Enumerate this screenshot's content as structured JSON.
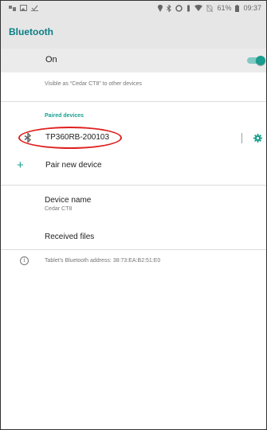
{
  "status_bar": {
    "left_icons": [
      "notification-icon",
      "image-icon",
      "checkmark-icon"
    ],
    "right_icons": [
      "location-icon",
      "bluetooth-icon",
      "data-saver-icon",
      "vibrate-icon",
      "wifi-icon",
      "no-sim-icon",
      "battery-icon"
    ],
    "battery_percent": "61%",
    "time": "09:37"
  },
  "app_bar": {
    "title": "Bluetooth"
  },
  "toggle": {
    "label": "On",
    "state": true,
    "accent": "#1a9c8e"
  },
  "visible_text": "Visible as “Cedar CT8” to other devices",
  "paired": {
    "header": "Paired devices",
    "devices": [
      {
        "name": "TP360RB-200103",
        "icon": "bluetooth-icon",
        "settings_icon": "gear-icon"
      }
    ]
  },
  "pair_new": {
    "label": "Pair new device",
    "icon": "plus-icon"
  },
  "device_name": {
    "title": "Device name",
    "value": "Cedar CT8"
  },
  "received_files": {
    "label": "Received files"
  },
  "address": {
    "icon": "info-icon",
    "text": "Tablet's Bluetooth address: 38:73:EA:B2:51:E0"
  },
  "colors": {
    "title": "#0a7d86",
    "accent": "#19a08e",
    "annotation": "#e02020"
  }
}
